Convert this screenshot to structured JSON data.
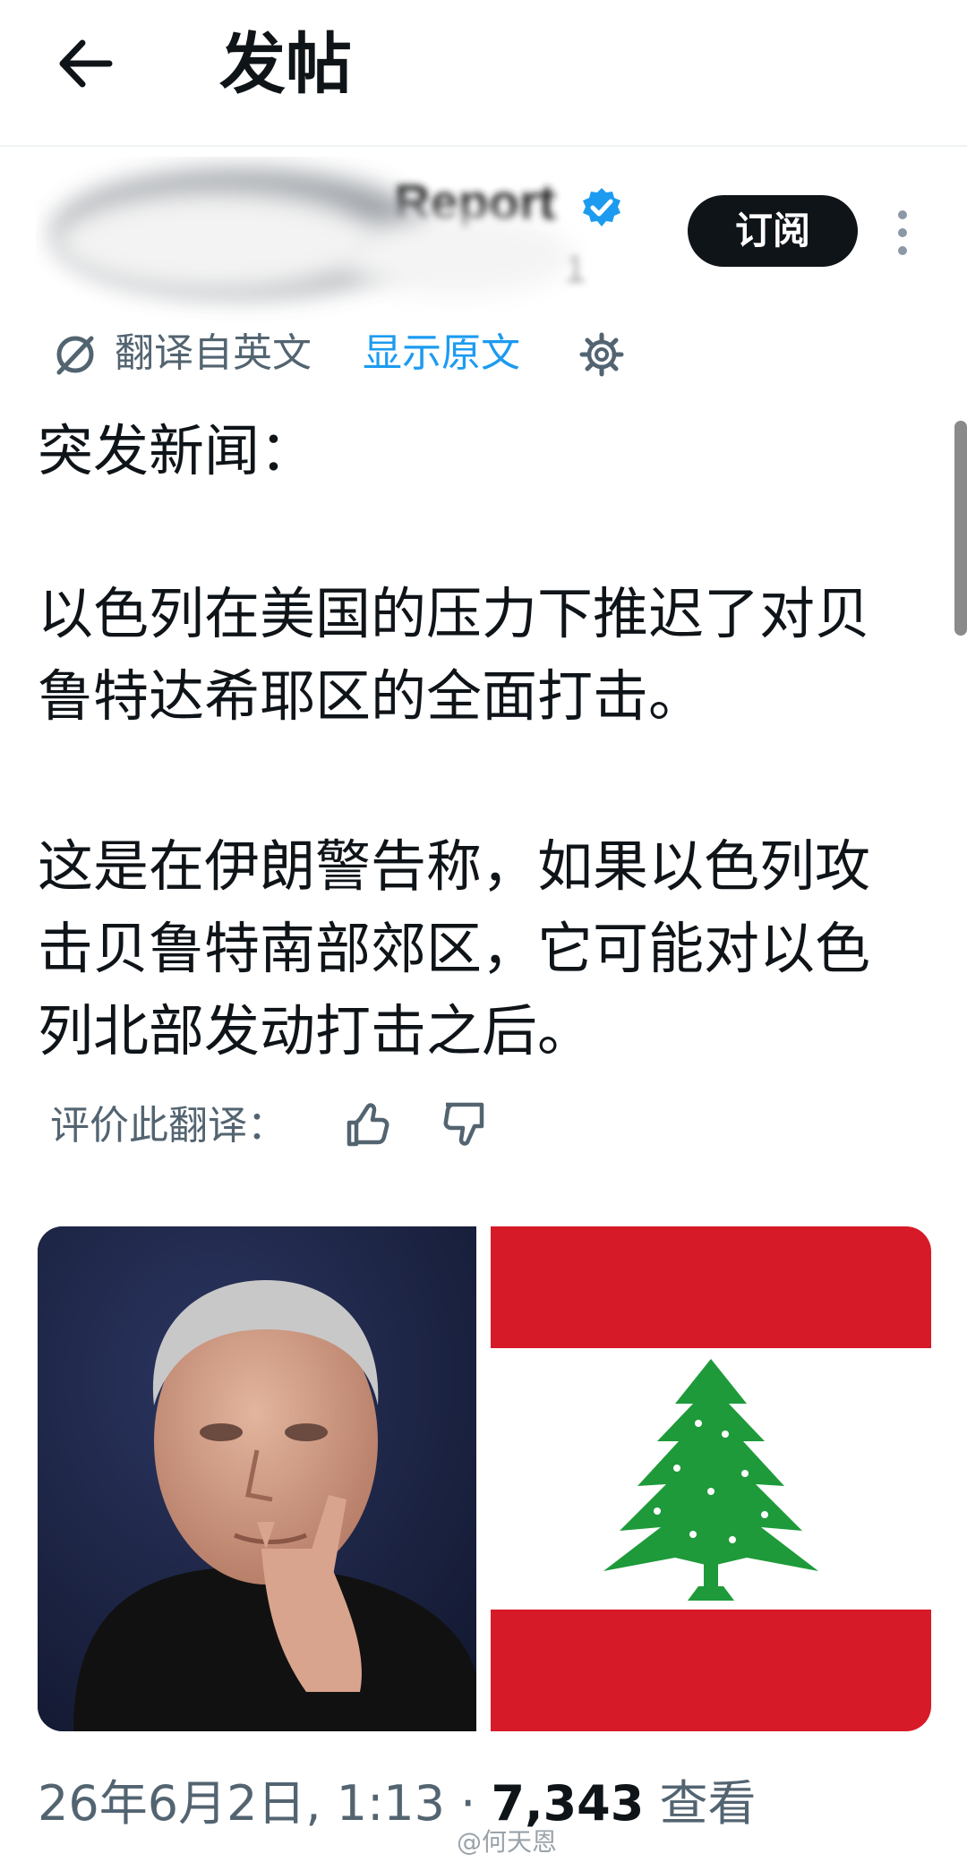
{
  "header": {
    "title": "发帖",
    "back_icon": "arrow-left-icon"
  },
  "author": {
    "name_partial": "Report",
    "handle_partial": "1",
    "verified_icon": "verified-badge-icon",
    "verified_color": "#1d9bf0",
    "subscribe_label": "订阅",
    "more_icon": "more-vertical-icon"
  },
  "translation": {
    "label": "翻译自英文",
    "show_original": "显示原文",
    "settings_icon": "gear-icon"
  },
  "post": {
    "line1": "突发新闻：",
    "line2": "以色列在美国的压力下推迟了对贝鲁特达希耶区的全面打击。",
    "line3": "这是在伊朗警告称，如果以色列攻击贝鲁特南部郊区，它可能对以色列北部发动打击之后。"
  },
  "rating": {
    "label": "评价此翻译：",
    "thumb_up_icon": "thumb-up-icon",
    "thumb_down_icon": "thumb-down-icon"
  },
  "media": {
    "left": "portrait-photo",
    "right": "lebanon-flag"
  },
  "meta": {
    "date_time": "26年6月2日, 1:13 · ",
    "views_count": "7,343",
    "views_label": " 查看"
  },
  "watermark": "@何天恩",
  "colors": {
    "accent": "#1d9bf0",
    "text_primary": "#0f1419",
    "text_secondary": "#536471",
    "flag_red": "#d71a28",
    "flag_green": "#1e9a3a"
  }
}
